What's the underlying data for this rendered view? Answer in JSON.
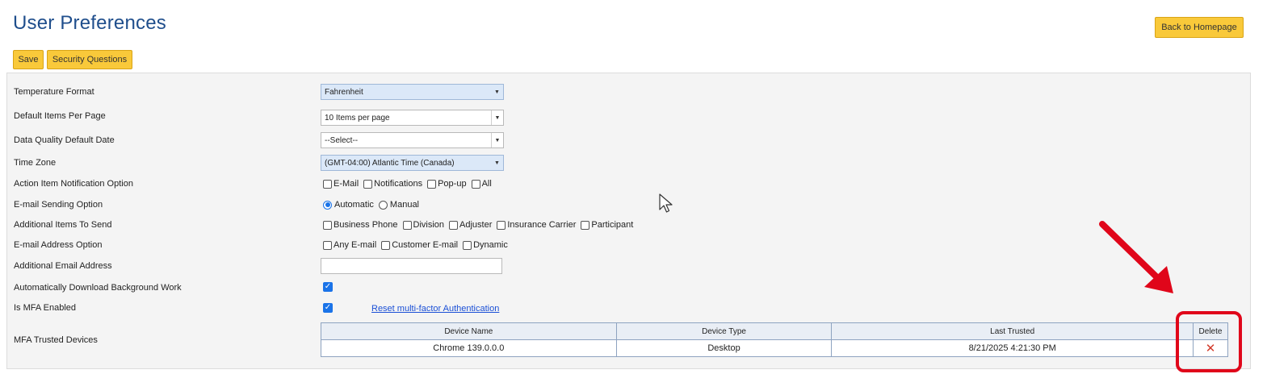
{
  "page": {
    "title": "User Preferences",
    "back_button": "Back to Homepage",
    "save_button": "Save",
    "security_button": "Security Questions"
  },
  "form": {
    "temperature": {
      "label": "Temperature Format",
      "value": "Fahrenheit"
    },
    "items_per_page": {
      "label": "Default Items Per Page",
      "value": "10 Items per page"
    },
    "dq_date": {
      "label": "Data Quality Default Date",
      "value": "--Select--"
    },
    "timezone": {
      "label": "Time Zone",
      "value": "(GMT-04:00) Atlantic Time (Canada)"
    },
    "notification": {
      "label": "Action Item Notification Option",
      "options": [
        "E-Mail",
        "Notifications",
        "Pop-up",
        "All"
      ]
    },
    "sending": {
      "label": "E-mail Sending Option",
      "options": [
        "Automatic",
        "Manual"
      ],
      "selected": "Automatic"
    },
    "additional_items": {
      "label": "Additional Items To Send",
      "options": [
        "Business Phone",
        "Division",
        "Adjuster",
        "Insurance Carrier",
        "Participant"
      ]
    },
    "address_option": {
      "label": "E-mail Address Option",
      "options": [
        "Any E-mail",
        "Customer E-mail",
        "Dynamic"
      ]
    },
    "additional_email": {
      "label": "Additional Email Address",
      "value": ""
    },
    "auto_download": {
      "label": "Automatically Download Background Work",
      "checked": true
    },
    "mfa": {
      "label": "Is MFA Enabled",
      "checked": true,
      "reset_link": "Reset multi-factor Authentication"
    },
    "trusted_devices": {
      "label": "MFA Trusted Devices",
      "columns": [
        "Device Name",
        "Device Type",
        "Last Trusted",
        "Delete"
      ],
      "rows": [
        {
          "name": "Chrome 139.0.0.0",
          "type": "Desktop",
          "last": "8/21/2025 4:21:30 PM",
          "delete": "✕"
        }
      ]
    }
  },
  "colors": {
    "accent_button": "#f9c93a",
    "title": "#1f4e8c",
    "annotation": "#e0061a",
    "link": "#1a4fd6"
  }
}
